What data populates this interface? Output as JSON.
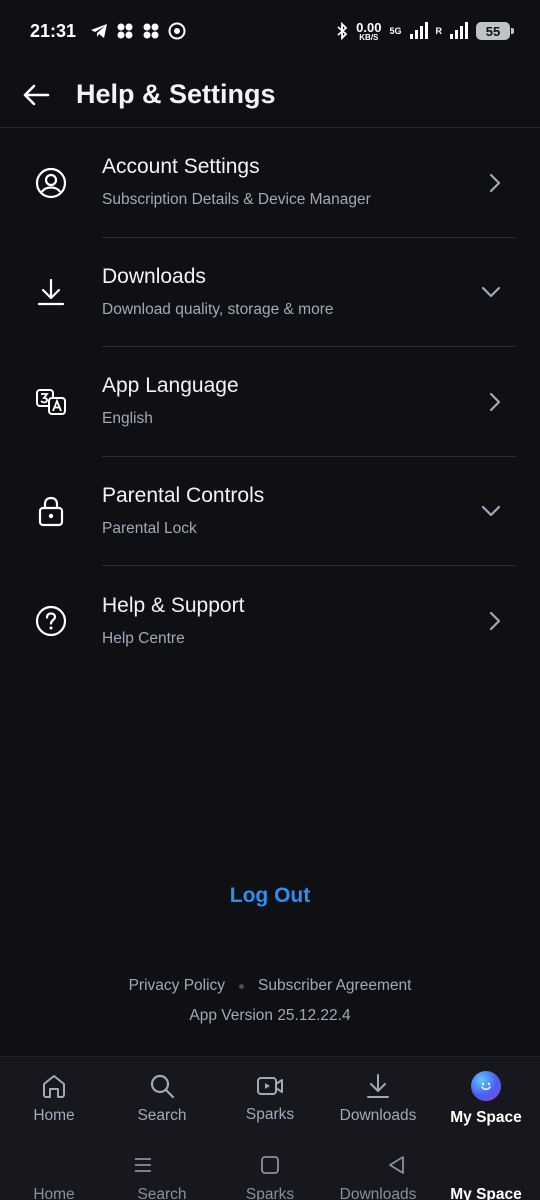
{
  "status_bar": {
    "time": "21:31",
    "net_speed_value": "0.00",
    "net_speed_unit": "KB/S",
    "network_type": "5G",
    "roaming_label": "R",
    "battery": "55"
  },
  "header": {
    "title": "Help & Settings"
  },
  "settings": {
    "items": [
      {
        "title": "Account Settings",
        "subtitle": "Subscription Details & Device Manager",
        "icon": "user-circle-icon",
        "chevron": "chevron-right-icon"
      },
      {
        "title": "Downloads",
        "subtitle": "Download quality, storage & more",
        "icon": "download-icon",
        "chevron": "chevron-down-icon"
      },
      {
        "title": "App Language",
        "subtitle": "English",
        "icon": "translate-icon",
        "chevron": "chevron-right-icon"
      },
      {
        "title": "Parental Controls",
        "subtitle": "Parental Lock",
        "icon": "lock-icon",
        "chevron": "chevron-down-icon"
      },
      {
        "title": "Help & Support",
        "subtitle": "Help Centre",
        "icon": "help-circle-icon",
        "chevron": "chevron-right-icon"
      }
    ]
  },
  "logout_label": "Log Out",
  "footer": {
    "privacy_policy": "Privacy Policy",
    "subscriber_agreement": "Subscriber Agreement",
    "app_version": "App Version 25.12.22.4"
  },
  "bottom_nav": {
    "items": [
      {
        "label": "Home",
        "icon": "home-icon",
        "active": false
      },
      {
        "label": "Search",
        "icon": "search-icon",
        "active": false
      },
      {
        "label": "Sparks",
        "icon": "video-icon",
        "active": false
      },
      {
        "label": "Downloads",
        "icon": "download-icon",
        "active": false
      },
      {
        "label": "My Space",
        "icon": "avatar",
        "active": true
      }
    ]
  },
  "colors": {
    "background": "#0f1014",
    "accent": "#2f8ff0",
    "secondary_text": "#a3a8b8"
  }
}
